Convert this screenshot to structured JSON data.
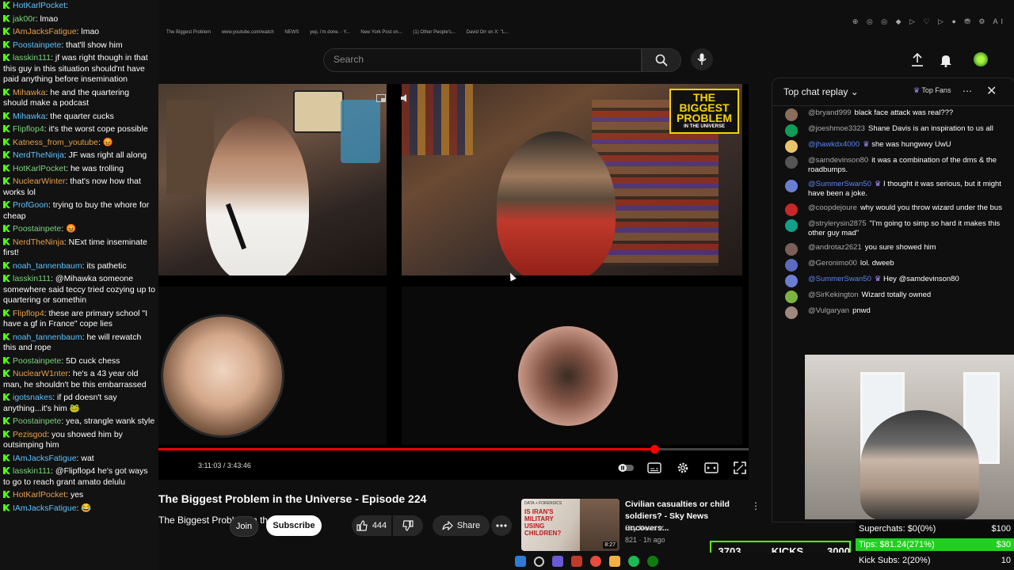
{
  "stream_chat": {
    "messages": [
      {
        "user": "HotKarlPocket",
        "text": ""
      },
      {
        "user": "jak00r",
        "text": "lmao"
      },
      {
        "user": "IAmJacksFatigue",
        "text": "lmao"
      },
      {
        "user": "Poostainpete",
        "text": "that'll show him"
      },
      {
        "user": "lasskin111",
        "text": "jf was right though in that this guy in this situation should'nt have paid anything before insemination"
      },
      {
        "user": "Mihawka",
        "text": "he and the quartering should make a podcast"
      },
      {
        "user": "Mihawka",
        "text": "the quarter cucks"
      },
      {
        "user": "Flipflop4",
        "text": "it's the worst cope possible"
      },
      {
        "user": "Katness_from_youtube",
        "text": "😡"
      },
      {
        "user": "NerdTheNinja",
        "text": "JF was right all along"
      },
      {
        "user": "HotKarlPocket",
        "text": "he was trolling"
      },
      {
        "user": "NuclearWinter",
        "text": "that's now how that works lol"
      },
      {
        "user": "ProfGoon",
        "text": "trying to buy the whore for cheap"
      },
      {
        "user": "Poostainpete",
        "text": "😡"
      },
      {
        "user": "NerdTheNinja",
        "text": "NExt time inseminate first!"
      },
      {
        "user": "noah_tannenbaum",
        "text": "its pathetic"
      },
      {
        "user": "lasskin111",
        "text": "@Mihawka someone somewhere said teccy tried cozying up to quartering or somethin"
      },
      {
        "user": "Flipflop4",
        "text": "these are primary school \"I have a gf in France\" cope lies"
      },
      {
        "user": "noah_tannenbaum",
        "text": "he will rewatch this and rope"
      },
      {
        "user": "Poostainpete",
        "text": "5D cuck chess"
      },
      {
        "user": "NuclearW1nter",
        "text": "he's a 43 year old man, he shouldn't be this embarrassed"
      },
      {
        "user": "igotsnakes",
        "text": "if pd doesn't say anything...it's him 🐸"
      },
      {
        "user": "Poostainpete",
        "text": "yea, strangle wank style"
      },
      {
        "user": "Pezisgod",
        "text": "you showed him by outsimping him"
      },
      {
        "user": "IAmJacksFatigue",
        "text": "wat"
      },
      {
        "user": "lasskin111",
        "text": "@Flipflop4 he's got ways to go to reach grant amato delulu"
      },
      {
        "user": "HotKarlPocket",
        "text": "yes"
      },
      {
        "user": "IAmJacksFatigue",
        "text": "😂"
      }
    ]
  },
  "browser": {
    "bookmarks": [
      "The Biggest Problem",
      "www.youtube.com/watch",
      "NEWS",
      "yep, i'm done. - Y...",
      "New York Post on...",
      "(1) Other People's...",
      "David Orr on X: \"L..."
    ],
    "ext_icons": "⊕ ◎ ◎ ◆ ▷ ♡ ▷ ● ⛃ ⚙ AI"
  },
  "header": {
    "search_placeholder": "Search"
  },
  "player": {
    "logo_line1": "THE",
    "logo_line2": "BIGGEST",
    "logo_line3": "PROBLEM",
    "logo_sub": "IN THE UNIVERSE",
    "time": "3:11:03 / 3:43:46",
    "progress": 0.84
  },
  "video": {
    "title": "The Biggest Problem in the Universe - Episode 224",
    "channel": "The Biggest Problem in the Universe",
    "join": "Join",
    "subscribe": "Subscribe",
    "likes": "444",
    "share": "Share"
  },
  "related": {
    "tag": "DATA + FORENSICS",
    "headline": "IS IRAN'S MILITARY USING CHILDREN?",
    "title": "Civilian casualties or child soldiers? - Sky News uncovers...",
    "channel": "Sky News",
    "meta": "821 · 1h ago",
    "duration": "8:27"
  },
  "yt_chat": {
    "header": "Top chat replay",
    "top_fans": "Top Fans",
    "messages": [
      {
        "author": "@bryand999",
        "text": "black face attack was real???",
        "color": "#8a6d5a",
        "mod": false
      },
      {
        "author": "@joeshmoe3323",
        "text": "Shane Davis is an inspiration to us all",
        "color": "#0f9d58",
        "mod": false
      },
      {
        "author": "@jhawkdx4000",
        "text": "she was hungwwy UwU",
        "color": "#e9c46a",
        "mod": true
      },
      {
        "author": "@samdevinson80",
        "text": "it was a combination of the dms & the roadbumps.",
        "color": "#555555",
        "mod": false
      },
      {
        "author": "@SummerSwan50",
        "text": "I thought it was serious, but it might have been a joke.",
        "color": "#6a7fd1",
        "mod": true
      },
      {
        "author": "@coopdejoure",
        "text": "why would you throw wizard under the bus",
        "color": "#c62828",
        "mod": false
      },
      {
        "author": "@strylerysin2875",
        "text": "\"I'm going to simp so hard it makes this other guy mad\"",
        "color": "#12a08a",
        "mod": false
      },
      {
        "author": "@androtaz2621",
        "text": "you sure showed him",
        "color": "#7b5e57",
        "mod": false
      },
      {
        "author": "@Geronimo00",
        "text": "lol. dweeb",
        "color": "#5c6bc0",
        "mod": false
      },
      {
        "author": "@SummerSwan50",
        "text": "Hey @samdevinson80",
        "color": "#6a7fd1",
        "mod": true
      },
      {
        "author": "@SirKekington",
        "text": "Wizard totally owned",
        "color": "#7cb342",
        "mod": false
      },
      {
        "author": "@Vulgaryan",
        "text": "pnwd",
        "color": "#a1887f",
        "mod": false
      }
    ]
  },
  "overlay": {
    "kicks_count": "3703",
    "kicks_label": "KICKS",
    "kicks_goal": "3000",
    "superchats_label": "Superchats:",
    "superchats_value": "$0(0%)",
    "superchats_goal": "$100",
    "superchats_fraction": 0,
    "tips_label": "Tips:",
    "tips_value": "$81.24(271%)",
    "tips_goal": "$30",
    "tips_fraction": 1,
    "subs_label": "Kick Subs:",
    "subs_value": "2(20%)",
    "subs_goal": "10",
    "subs_fraction": 0.2
  }
}
